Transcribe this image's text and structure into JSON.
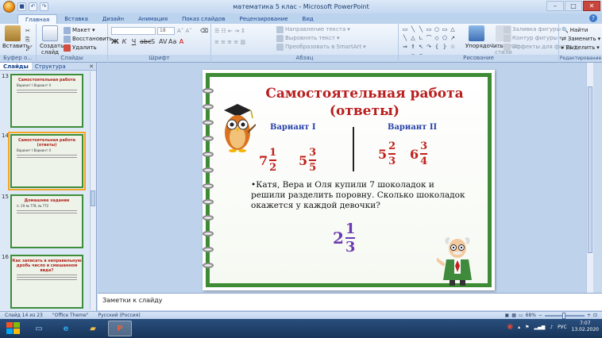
{
  "window": {
    "title": "математика 5 клас  -  Microsoft PowerPoint"
  },
  "ribbon": {
    "tabs": [
      "Главная",
      "Вставка",
      "Дизайн",
      "Анимация",
      "Показ слайдов",
      "Рецензирование",
      "Вид"
    ],
    "active_tab": "Главная",
    "clipboard": {
      "paste": "Вставить",
      "label": "Буфер о..."
    },
    "slides": {
      "create": "Создать слайд",
      "layout": "Макет",
      "reset": "Восстановить",
      "delete": "Удалить",
      "label": "Слайды"
    },
    "font": {
      "font_name": "",
      "font_size": "18",
      "label": "Шрифт"
    },
    "paragraph": {
      "text_direction": "Направление текста",
      "align_text": "Выровнять текст",
      "smartart": "Преобразовать в SmartArt",
      "label": "Абзац"
    },
    "drawing": {
      "arrange": "Упорядочить",
      "quick_styles": "Экспресс-стили",
      "fill": "Заливка фигуры",
      "outline": "Контур фигуры",
      "effects": "Эффекты для фигур",
      "label": "Рисование"
    },
    "editing": {
      "find": "Найти",
      "replace": "Заменить",
      "select": "Выделить",
      "label": "Редактирование"
    }
  },
  "left_panel": {
    "tabs": [
      "Слайды",
      "Структура"
    ],
    "thumbnails": [
      {
        "number": "13",
        "title": "Самостоятельная работа",
        "text": "Вариант I   Вариант II"
      },
      {
        "number": "14",
        "title": "Самостоятельная работа (ответы)",
        "text": "Вариант I   Вариант II"
      },
      {
        "number": "15",
        "title": "Домашнее задание",
        "text": "п. 29 № 778, № 772"
      },
      {
        "number": "16",
        "title": "Как записать в неправильную дробь число в смешанном виде?",
        "text": ""
      }
    ]
  },
  "slide": {
    "title": "Самостоятельная работа (ответы)",
    "variant1": "Вариант I",
    "variant2": "Вариант II",
    "v1_answers": [
      {
        "whole": "7",
        "num": "1",
        "den": "2"
      },
      {
        "whole": "5",
        "num": "3",
        "den": "5"
      }
    ],
    "v2_answers": [
      {
        "whole": "5",
        "num": "2",
        "den": "3"
      },
      {
        "whole": "6",
        "num": "3",
        "den": "4"
      }
    ],
    "problem": "•Катя, Вера и Оля купили 7 шоколадок и решили разделить поровну. Сколько шоколадок окажется у каждой девочки?",
    "answer": {
      "whole": "2",
      "num": "1",
      "den": "3"
    }
  },
  "notes": {
    "placeholder": "Заметки к слайду"
  },
  "status": {
    "slide_info": "Слайд 14 из 23",
    "theme": "\"Office Theme\"",
    "language": "Русский (Россия)",
    "zoom": "68%"
  },
  "taskbar": {
    "language": "РУС",
    "time": "7:07",
    "date": "13.02.2020"
  },
  "colors": {
    "title_red": "#b91e1e",
    "variant_blue": "#2740a8",
    "answer_purple": "#6a3bb0",
    "frame_green": "#3d8c35"
  }
}
